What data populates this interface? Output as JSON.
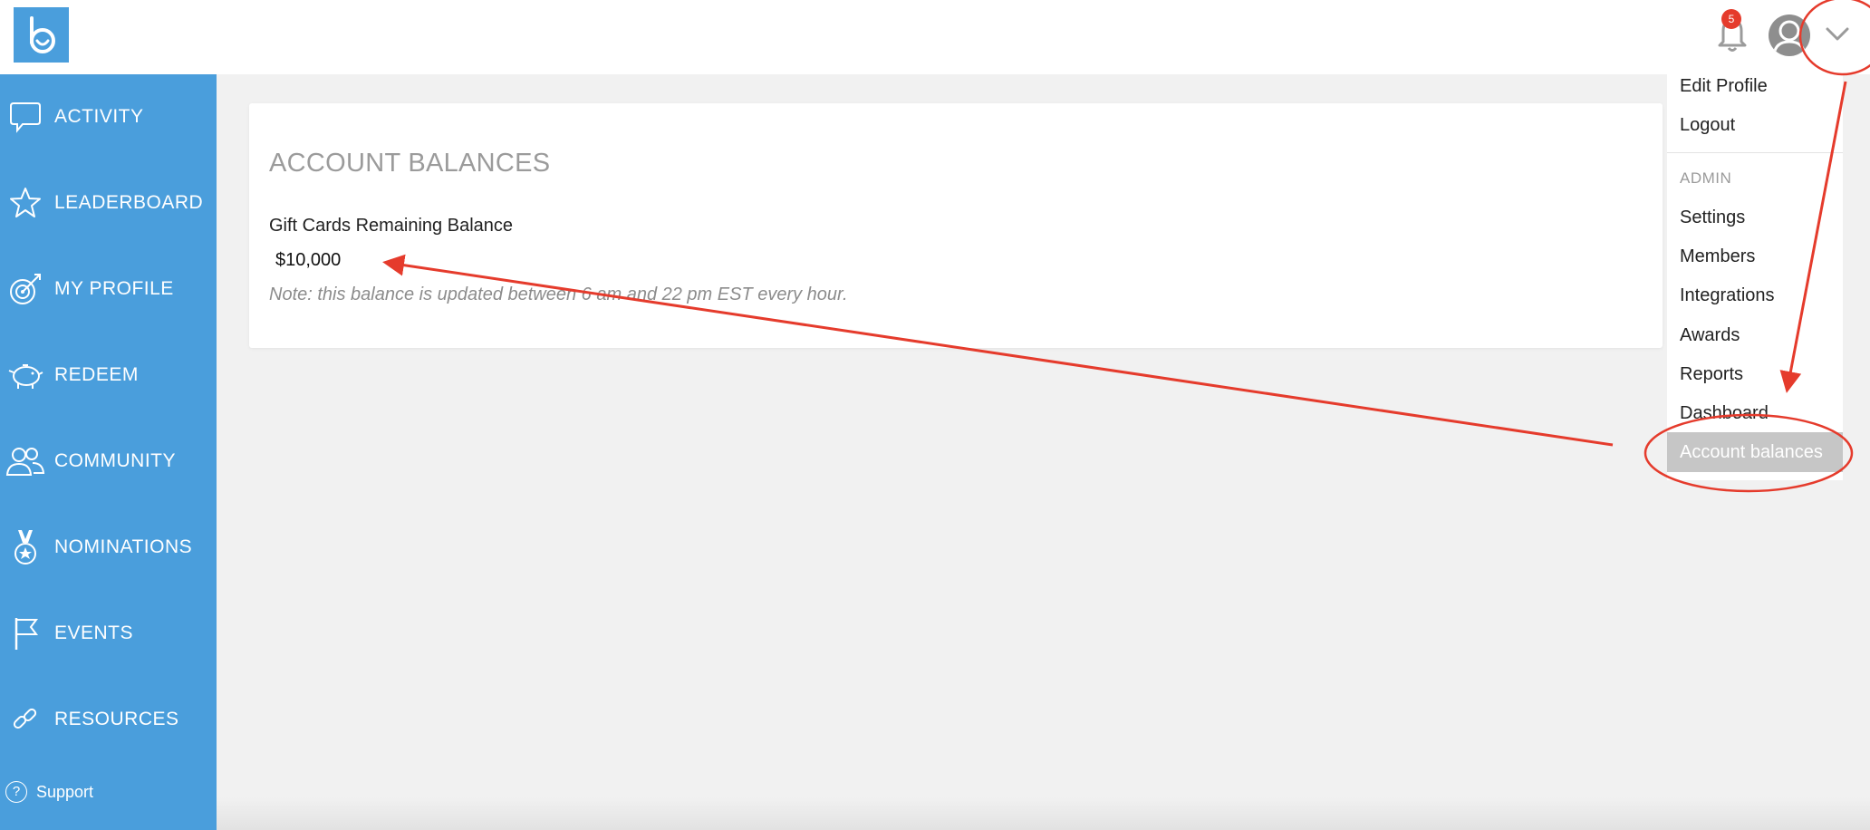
{
  "header": {
    "notification_count": "5"
  },
  "sidebar": {
    "items": [
      {
        "label": "ACTIVITY",
        "icon": "chat-bubble-icon"
      },
      {
        "label": "LEADERBOARD",
        "icon": "star-icon"
      },
      {
        "label": "MY PROFILE",
        "icon": "target-arrow-icon"
      },
      {
        "label": "REDEEM",
        "icon": "piggy-bank-icon"
      },
      {
        "label": "COMMUNITY",
        "icon": "people-icon"
      },
      {
        "label": "NOMINATIONS",
        "icon": "medal-icon"
      },
      {
        "label": "EVENTS",
        "icon": "flag-icon"
      },
      {
        "label": "RESOURCES",
        "icon": "link-icon"
      }
    ],
    "support_label": "Support"
  },
  "card": {
    "title": "ACCOUNT BALANCES",
    "subtitle": "Gift Cards Remaining Balance",
    "amount": "$10,000",
    "note": "Note: this balance is updated between 6 am and 22 pm EST every hour."
  },
  "dropdown": {
    "user_items": [
      "Edit Profile",
      "Logout"
    ],
    "admin_header": "ADMIN",
    "admin_items": [
      "Settings",
      "Members",
      "Integrations",
      "Awards",
      "Reports",
      "Dashboard"
    ],
    "active_item": "Account balances"
  },
  "colors": {
    "sidebar": "#4a9edc",
    "annotation": "#e53b2c",
    "background": "#f1f1f1",
    "active_item": "#c6c6c6"
  }
}
